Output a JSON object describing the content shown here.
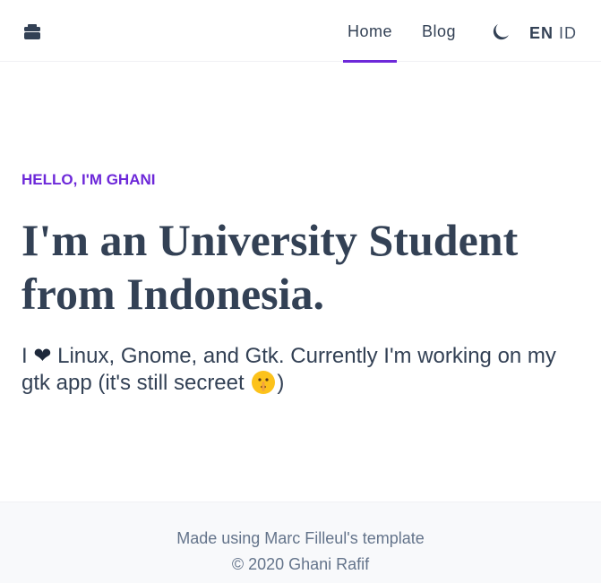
{
  "header": {
    "logo_icon": "briefcase-icon",
    "nav": [
      {
        "label": "Home",
        "active": true
      },
      {
        "label": "Blog",
        "active": false
      }
    ],
    "theme_toggle_icon": "moon-icon",
    "languages": [
      {
        "label": "EN",
        "selected": true
      },
      {
        "label": "ID",
        "selected": false
      }
    ]
  },
  "hero": {
    "eyebrow": "HELLO, I'M GHANI",
    "title": "I'm an University Student from Indonesia.",
    "desc_before_heart": "I",
    "heart": "❤",
    "desc_after_heart": "Linux, Gnome, and Gtk. Currently I'm working on my gtk app (it's still secreet",
    "emoji_icon": "shushing-face-icon",
    "desc_end": ")"
  },
  "footer": {
    "line1": "Made using Marc Filleul's template",
    "line2": "© 2020 Ghani Rafif"
  },
  "colors": {
    "accent": "#6d28d9",
    "text": "#334155",
    "footer_bg": "#f8f9fb"
  }
}
